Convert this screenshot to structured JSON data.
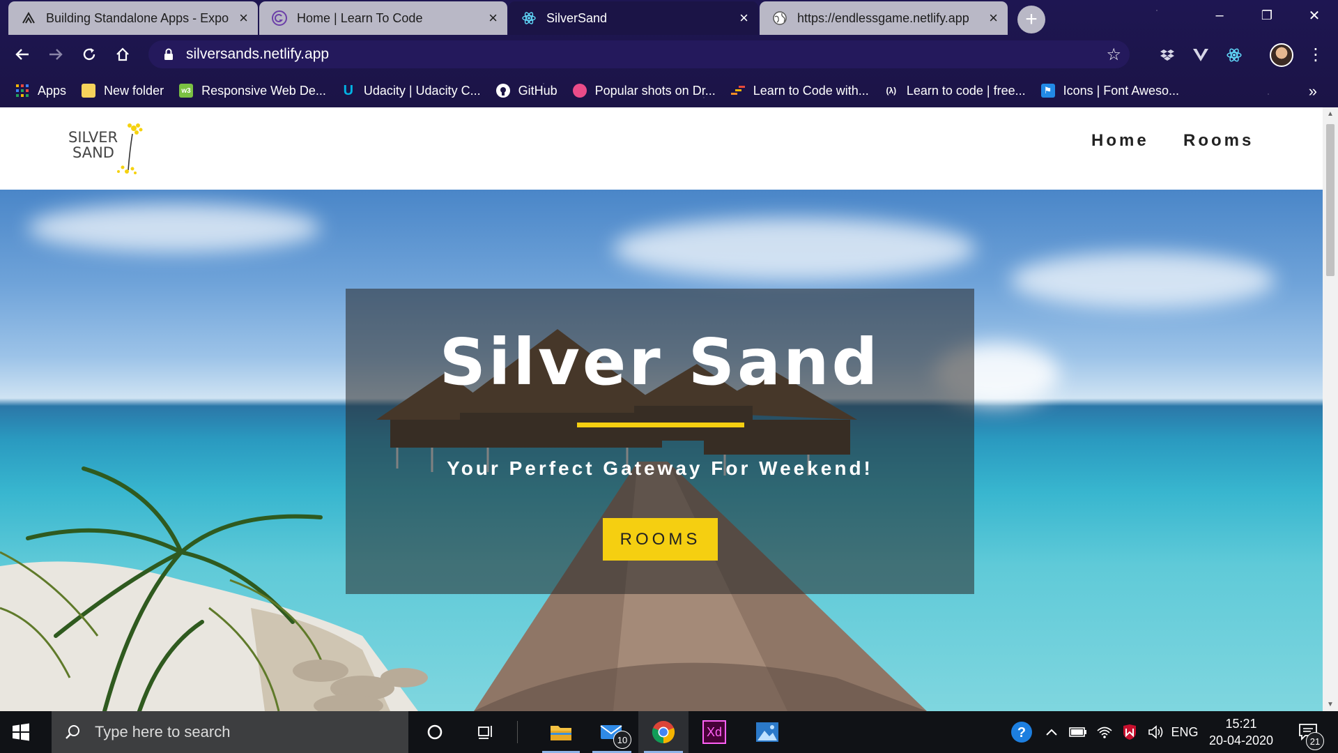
{
  "browser": {
    "tabs": [
      {
        "title": "Building Standalone Apps - Expo",
        "active": false
      },
      {
        "title": "Home | Learn To Code",
        "active": false
      },
      {
        "title": "SilverSand",
        "active": true
      },
      {
        "title": "https://endlessgame.netlify.app",
        "active": false
      }
    ],
    "new_tab": "+",
    "window_controls": {
      "minimize": "–",
      "restore": "❐",
      "close": "✕"
    },
    "url": "silversands.netlify.app",
    "bookmarks": [
      {
        "label": "Apps",
        "icon": "apps-grid-icon"
      },
      {
        "label": "New folder",
        "icon": "folder-icon"
      },
      {
        "label": "Responsive Web De...",
        "icon": "responsive-web-icon"
      },
      {
        "label": "Udacity | Udacity C...",
        "icon": "udacity-icon"
      },
      {
        "label": "GitHub",
        "icon": "github-icon"
      },
      {
        "label": "Popular shots on Dr...",
        "icon": "dribbble-icon"
      },
      {
        "label": "Learn to Code with...",
        "icon": "learn-code-icon"
      },
      {
        "label": "Learn to code | free...",
        "icon": "freecodecamp-icon"
      },
      {
        "label": "Icons | Font Aweso...",
        "icon": "font-awesome-icon"
      }
    ],
    "bookmarks_more": "»"
  },
  "site": {
    "logo_line1": "SILVER",
    "logo_line2": "SAND",
    "nav": {
      "home": "Home",
      "rooms": "Rooms"
    },
    "hero": {
      "title": "Silver Sand",
      "subtitle": "Your Perfect Gateway For Weekend!",
      "button": "ROOMS",
      "accent_color": "#f5cf11"
    }
  },
  "taskbar": {
    "search_placeholder": "Type here to search",
    "mail_badge": "10",
    "language": "ENG",
    "time": "15:21",
    "date": "20-04-2020",
    "notification_badge": "21",
    "xd_label": "Xd"
  }
}
